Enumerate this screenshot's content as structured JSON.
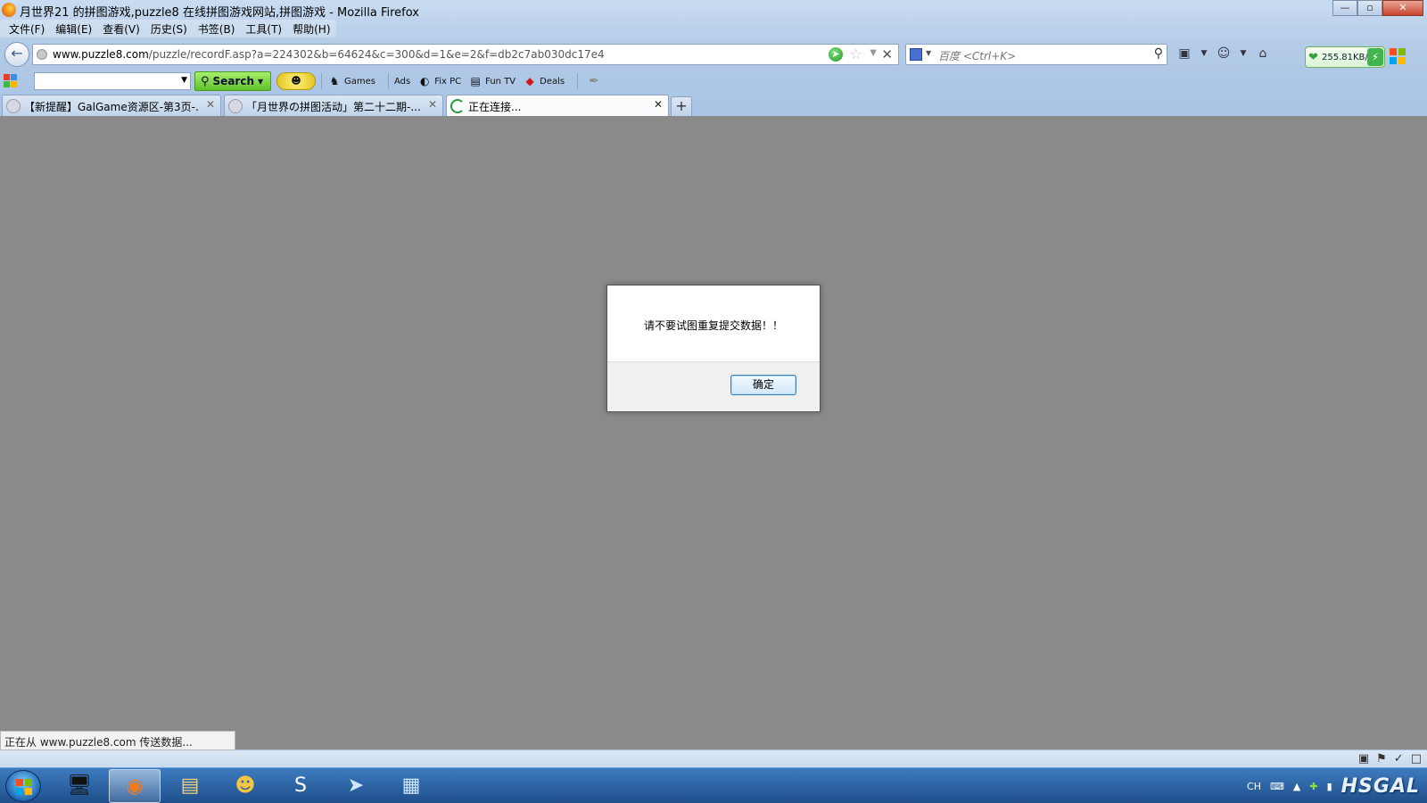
{
  "window": {
    "title": "月世界21 的拼图游戏,puzzle8 在线拼图游戏网站,拼图游戏 - Mozilla Firefox",
    "buttons": {
      "minimize": "—",
      "maximize": "▫",
      "close": "✕"
    }
  },
  "menu": {
    "items": [
      "文件(F)",
      "编辑(E)",
      "查看(V)",
      "历史(S)",
      "书签(B)",
      "工具(T)",
      "帮助(H)"
    ]
  },
  "navbar": {
    "url_host": "www.puzzle8.com",
    "url_path": "/puzzle/recordF.asp?a=224302&b=64624&c=300&d=1&e=2&f=db2c7ab030dc17e4",
    "search_placeholder": "百度 <Ctrl+K>",
    "speed": "255.81KB/s"
  },
  "toolbar": {
    "search_value": "",
    "search_label": "Search",
    "items": [
      {
        "label": "Games",
        "icon": "joystick-icon"
      },
      {
        "label": "Ads",
        "icon": ""
      },
      {
        "label": "Fix PC",
        "icon": "gauge-icon"
      },
      {
        "label": "Fun TV",
        "icon": "tv-icon"
      },
      {
        "label": "Deals",
        "icon": "tag-icon"
      }
    ]
  },
  "tabs": [
    {
      "label": "【新提醒】GalGame资源区-第3页-...",
      "active": false
    },
    {
      "label": "「月世界の拼图活动」第二十二期-...",
      "active": false
    },
    {
      "label": "正在连接...",
      "active": true
    }
  ],
  "dialog": {
    "message": "请不要试图重复提交数据！！",
    "ok_label": "确定"
  },
  "status": {
    "text": "正在从 www.puzzle8.com 传送数据..."
  },
  "taskbar": {
    "tray_lang": "CH",
    "brand": "HSGAL"
  },
  "colors": {
    "content_bg": "#8a8a8a",
    "chrome_bg": "#b3cbe7",
    "taskbar_bg": "#2a5e9e",
    "search_button": "#5fc02a",
    "loading_spinner": "#2a9a3a"
  }
}
